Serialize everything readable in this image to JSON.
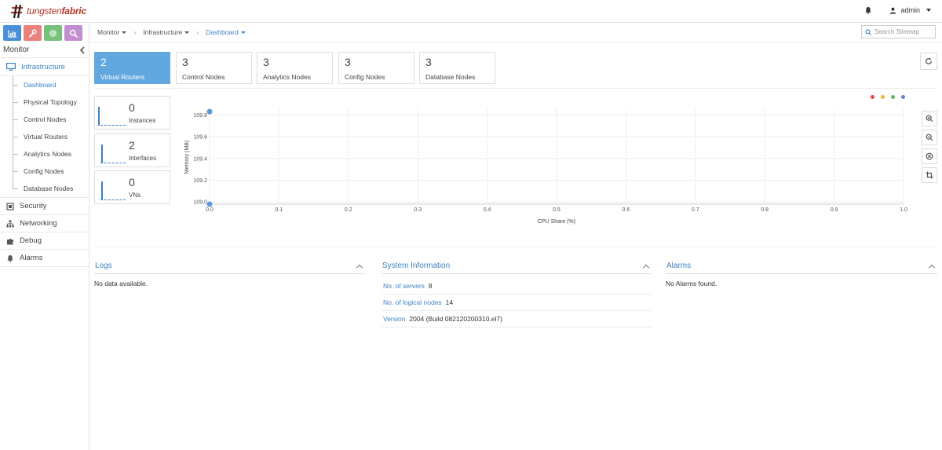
{
  "brand": {
    "name_light": "tungsten",
    "name_bold": "fabric"
  },
  "header": {
    "user": "admin"
  },
  "sidebar": {
    "title": "Monitor",
    "mode_tabs": [
      {
        "icon": "bar-chart-icon",
        "color": "#4a90d9"
      },
      {
        "icon": "wrench-icon",
        "color": "#e8827c"
      },
      {
        "icon": "gear-icon",
        "color": "#77c27b"
      },
      {
        "icon": "search-icon",
        "color": "#c38ed0"
      }
    ],
    "infrastructure": "Infrastructure",
    "items": [
      {
        "label": "Dashboard"
      },
      {
        "label": "Physical Topology"
      },
      {
        "label": "Control Nodes"
      },
      {
        "label": "Virtual Routers"
      },
      {
        "label": "Analytics Nodes"
      },
      {
        "label": "Config Nodes"
      },
      {
        "label": "Database Nodes"
      }
    ],
    "groups": [
      {
        "label": "Security",
        "icon": "security-icon"
      },
      {
        "label": "Networking",
        "icon": "sitemap-icon"
      },
      {
        "label": "Debug",
        "icon": "puzzle-icon"
      },
      {
        "label": "Alarms",
        "icon": "bell-icon"
      }
    ]
  },
  "breadcrumb": {
    "items": [
      "Monitor",
      "Infrastructure",
      "Dashboard"
    ]
  },
  "search": {
    "placeholder": "Search Sitemap"
  },
  "tiles": [
    {
      "value": "2",
      "label": "Virtual Routers",
      "active": true
    },
    {
      "value": "3",
      "label": "Control Nodes"
    },
    {
      "value": "3",
      "label": "Analytics Nodes"
    },
    {
      "value": "3",
      "label": "Config Nodes"
    },
    {
      "value": "3",
      "label": "Database Nodes"
    }
  ],
  "stats": [
    {
      "value": "0",
      "label": "Instances"
    },
    {
      "value": "2",
      "label": "Interfaces"
    },
    {
      "value": "0",
      "label": "VNs"
    }
  ],
  "legend_colors": [
    "#e24b4b",
    "#f5b041",
    "#5cb85c",
    "#6f7fd9"
  ],
  "chart_data": {
    "type": "scatter",
    "xlabel": "CPU Share (%)",
    "ylabel": "Memory (MB)",
    "xlim": [
      0,
      1.0
    ],
    "ylim": [
      108.98,
      109.86
    ],
    "x_ticks": [
      "0.0",
      "0.1",
      "0.2",
      "0.3",
      "0.4",
      "0.5",
      "0.6",
      "0.7",
      "0.8",
      "0.9",
      "1.0"
    ],
    "y_ticks": [
      "109.0",
      "109.2",
      "109.4",
      "109.6",
      "109.8"
    ],
    "points": [
      {
        "x": 0.0,
        "y": 109.83
      },
      {
        "x": 0.0,
        "y": 108.98
      }
    ],
    "color": "#5b9bd5",
    "grid": true
  },
  "logs": {
    "title": "Logs",
    "empty": "No data available."
  },
  "system_info": {
    "title": "System Information",
    "rows": [
      {
        "key": "No. of servers",
        "value": "8"
      },
      {
        "key": "No. of logical nodes",
        "value": "14"
      },
      {
        "key": "Version",
        "value": "2004 (Build 082120200310.el7)"
      }
    ]
  },
  "alarms": {
    "title": "Alarms",
    "empty": "No Alarms found."
  }
}
